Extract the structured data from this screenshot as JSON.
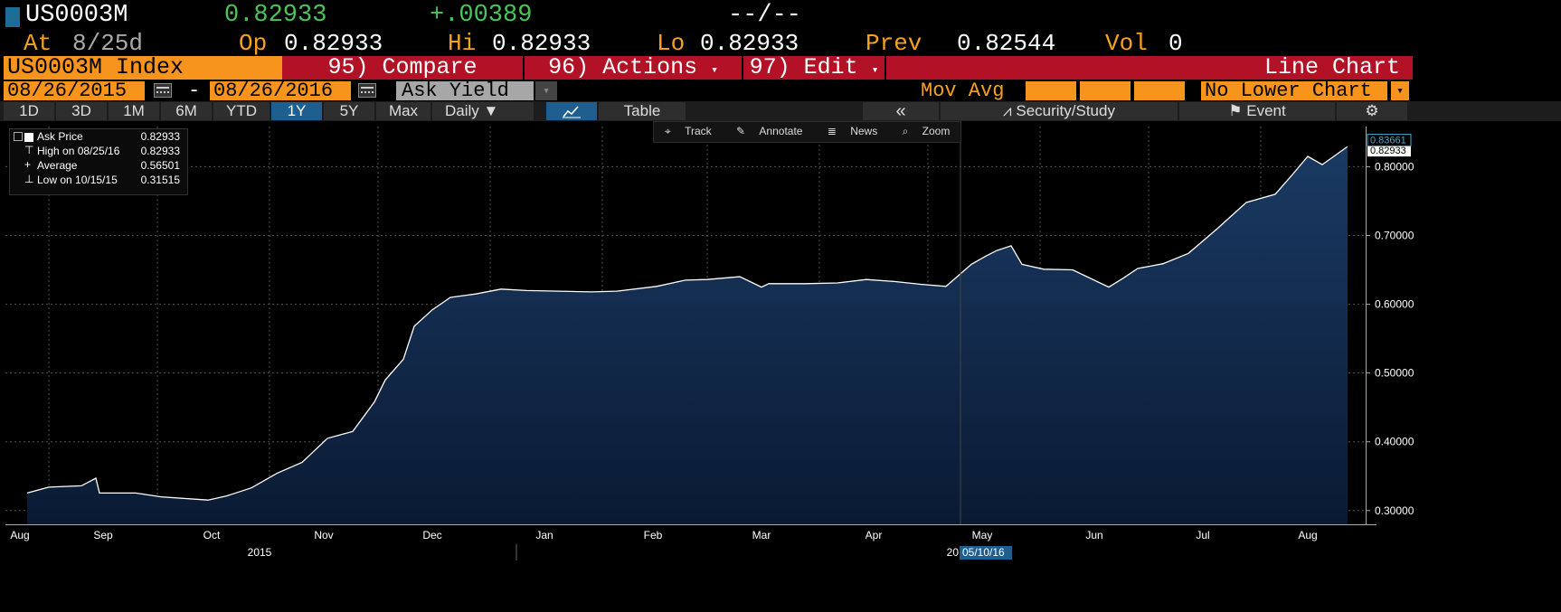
{
  "header": {
    "ticker": "US0003M",
    "last": "0.82933",
    "change": "+.00389",
    "bidask": "--/--"
  },
  "quote": {
    "at_label": "At",
    "at_value": "8/25d",
    "op_label": "Op",
    "op_value": "0.82933",
    "hi_label": "Hi",
    "hi_value": "0.82933",
    "lo_label": "Lo",
    "lo_value": "0.82933",
    "prev_label": "Prev",
    "prev_value": "0.82544",
    "vol_label": "Vol",
    "vol_value": "0"
  },
  "menu": {
    "security": "US0003M Index",
    "compare": "95) Compare",
    "actions": "96) Actions",
    "edit": "97) Edit",
    "chart_type": "Line Chart"
  },
  "range": {
    "start": "08/26/2015",
    "sep": "-",
    "end": "08/26/2016",
    "field": "Ask Yield",
    "mov_avg": "Mov Avg",
    "lower_chart": "No Lower Chart"
  },
  "toolbar": {
    "periods": [
      "1D",
      "3D",
      "1M",
      "6M",
      "YTD",
      "1Y",
      "5Y",
      "Max"
    ],
    "selected_period": "1Y",
    "frequency": "Daily",
    "table_label": "Table",
    "collapse_label": "«",
    "security_study": "Security/Study",
    "event": "Event"
  },
  "chart_tools": {
    "track": "Track",
    "annotate": "Annotate",
    "news": "News",
    "zoom": "Zoom"
  },
  "legend": {
    "title": "Ask Price",
    "title_value": "0.82933",
    "high_label": "High on 08/25/16",
    "high_value": "0.82933",
    "avg_label": "Average",
    "avg_value": "0.56501",
    "low_label": "Low on 10/15/15",
    "low_value": "0.31515"
  },
  "chart_data": {
    "type": "area",
    "title": "",
    "xlabel": "",
    "ylabel": "",
    "ylim": [
      0.28,
      0.84
    ],
    "yticks": [
      0.3,
      0.4,
      0.5,
      0.6,
      0.7,
      0.8
    ],
    "ytick_labels": [
      "0.30000",
      "0.40000",
      "0.50000",
      "0.60000",
      "0.70000",
      "0.80000"
    ],
    "xticks": [
      "Aug",
      "Sep",
      "Oct",
      "Nov",
      "Dec",
      "Jan",
      "Feb",
      "Mar",
      "Apr",
      "May",
      "Jun",
      "Jul",
      "Aug"
    ],
    "year_labels": [
      "2015"
    ],
    "last_value_label": "0.82933",
    "max_marker_label": "0.83661",
    "crosshair_date": "05/10/16",
    "crosshair_prefix": "20",
    "colors": {
      "line": "#ffffff",
      "fill_top": "#1a3a63",
      "fill_bottom": "#0a1a33",
      "grid": "#555555"
    },
    "x": [
      "2015-08-26",
      "2015-09-01",
      "2015-09-10",
      "2015-09-14",
      "2015-09-15",
      "2015-09-17",
      "2015-09-25",
      "2015-10-02",
      "2015-10-15",
      "2015-10-20",
      "2015-10-27",
      "2015-11-03",
      "2015-11-10",
      "2015-11-17",
      "2015-11-24",
      "2015-11-30",
      "2015-12-03",
      "2015-12-08",
      "2015-12-11",
      "2015-12-16",
      "2015-12-21",
      "2015-12-28",
      "2016-01-04",
      "2016-01-11",
      "2016-01-20",
      "2016-01-29",
      "2016-02-05",
      "2016-02-16",
      "2016-02-24",
      "2016-03-01",
      "2016-03-10",
      "2016-03-16",
      "2016-03-18",
      "2016-03-28",
      "2016-04-06",
      "2016-04-14",
      "2016-04-22",
      "2016-04-29",
      "2016-05-06",
      "2016-05-13",
      "2016-05-17",
      "2016-05-20",
      "2016-05-24",
      "2016-05-27",
      "2016-06-02",
      "2016-06-10",
      "2016-06-20",
      "2016-06-24",
      "2016-06-28",
      "2016-07-05",
      "2016-07-12",
      "2016-07-20",
      "2016-07-28",
      "2016-08-05",
      "2016-08-10",
      "2016-08-14",
      "2016-08-18",
      "2016-08-25"
    ],
    "y": [
      0.3255,
      0.334,
      0.336,
      0.347,
      0.3255,
      0.3255,
      0.3255,
      0.32,
      0.3152,
      0.321,
      0.333,
      0.354,
      0.37,
      0.405,
      0.415,
      0.458,
      0.49,
      0.52,
      0.568,
      0.592,
      0.61,
      0.615,
      0.622,
      0.62,
      0.619,
      0.618,
      0.619,
      0.626,
      0.635,
      0.636,
      0.64,
      0.625,
      0.63,
      0.63,
      0.631,
      0.636,
      0.633,
      0.629,
      0.626,
      0.658,
      0.67,
      0.678,
      0.685,
      0.658,
      0.651,
      0.65,
      0.625,
      0.638,
      0.652,
      0.659,
      0.674,
      0.71,
      0.748,
      0.76,
      0.79,
      0.815,
      0.803,
      0.8293
    ]
  }
}
